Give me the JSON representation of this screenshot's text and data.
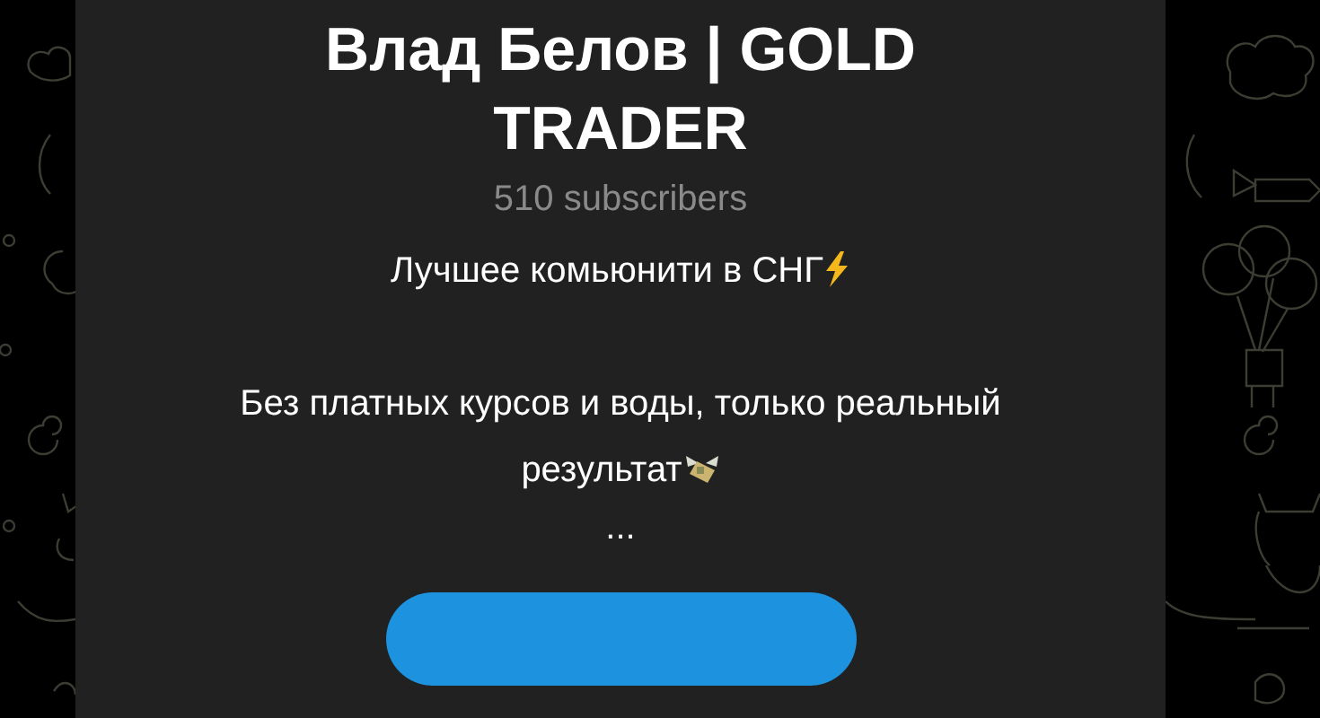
{
  "channel": {
    "title": "Влад Белов | GOLD TRADER",
    "subscribers": "510 subscribers",
    "description": [
      {
        "text": "Лучшее комьюнити в СНГ",
        "kind": "lightning"
      },
      {
        "text": "Без платных курсов и воды, только реальный результат",
        "kind": "money"
      },
      {
        "text": "...",
        "kind": "plain"
      }
    ]
  }
}
